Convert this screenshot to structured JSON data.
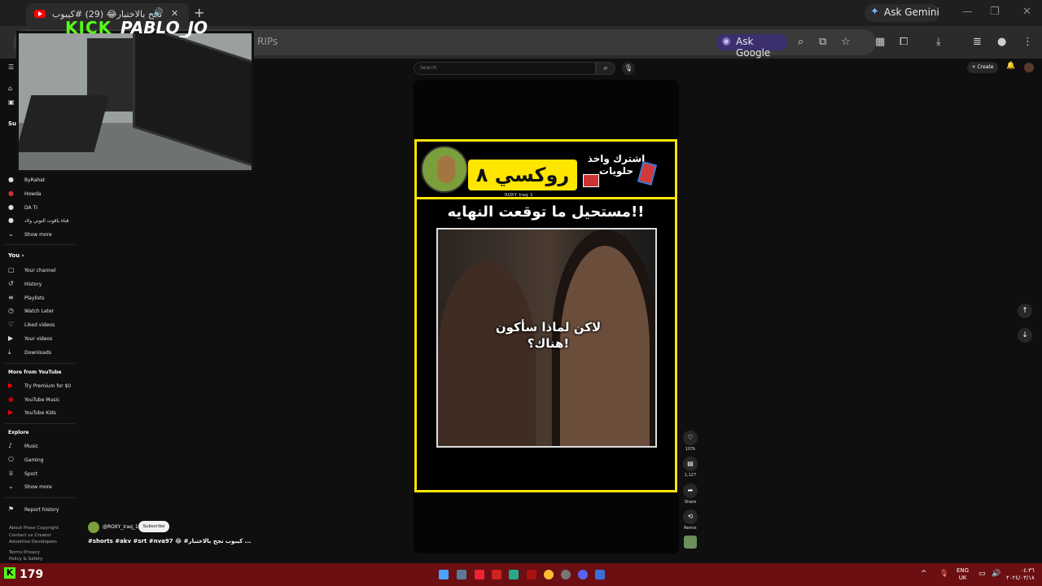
{
  "browser": {
    "tab_title": "نجح بالاختبار😂 (29) #كيبوب",
    "new_tab": "+",
    "ask_gemini": "Ask Gemini",
    "url_fragment": "RIPs",
    "ask_google": "Ask Google",
    "window_controls": [
      "—",
      "❐",
      "✕"
    ]
  },
  "stream_overlay": {
    "platform": "KICK",
    "streamer": "PABLO_JO",
    "viewer_count": "179"
  },
  "youtube": {
    "search_placeholder": "Search",
    "create_label": "+ Create",
    "notif_badge": "9+",
    "sidebar": {
      "subs_title": "Sul",
      "subscriptions": [
        "ByRahat",
        "Howda",
        "DA TI",
        "قناة ياقوت التوتي ولاد",
        "Show more"
      ],
      "you_title": "You  ›",
      "you_items": [
        "Your channel",
        "History",
        "Playlists",
        "Watch Later",
        "Liked videos",
        "Your videos",
        "Downloads"
      ],
      "more_title": "More from YouTube",
      "more_items": [
        "Try Premium for $0",
        "YouTube Music",
        "YouTube Kids"
      ],
      "explore_title": "Explore",
      "explore_items": [
        "Music",
        "Gaming",
        "Sport",
        "Show more"
      ],
      "report": "Report history",
      "footer": [
        "About  Press  Copyright",
        "Contact us  Creator",
        "Advertise  Developers",
        "Terms  Privacy",
        "Policy & Safety"
      ]
    },
    "short": {
      "brand": "روكسي ٨",
      "channel_tag": "ROXY_Iraq_1",
      "subscribe_promo": "اشترك واخذ حلويات",
      "headline": "مستحيل ما توقعت النهايه!!",
      "subtitle_line1": "لاكن لماذا سأكون",
      "subtitle_line2": "هناك؟!",
      "likes": "107k",
      "comments": "1,127",
      "share": "Share",
      "remix": "Remix"
    },
    "channel": {
      "name": "@ROXY_Iraq_1",
      "subscribe": "Subscribe",
      "description": "#shorts #akv #srt #nva97 😂 #كيبوب نجح بالاختبار ..."
    }
  },
  "taskbar": {
    "lang_line1": "ENG",
    "lang_line2": "UK",
    "time": "٠٤:٣٦",
    "date": "٢٠٢٤/٠٣/١٨"
  },
  "colors": {
    "frame_yellow": "#ffe600",
    "kick_green": "#53fc18",
    "taskbar": "#6b0f12"
  }
}
